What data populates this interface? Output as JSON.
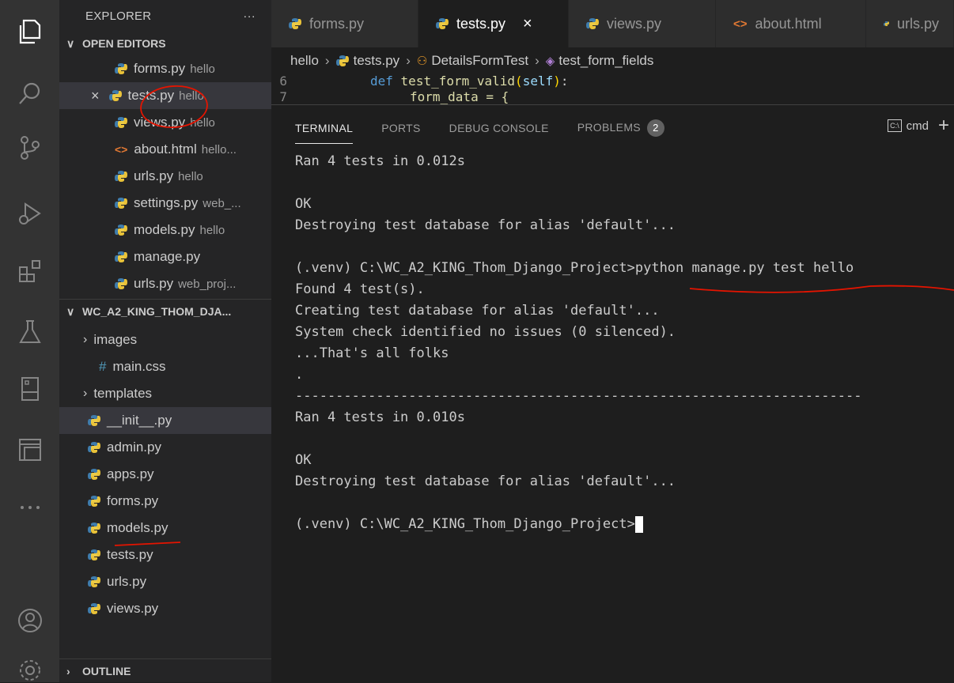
{
  "sidebar": {
    "title": "EXPLORER",
    "more": "···",
    "open_editors": {
      "label": "OPEN EDITORS",
      "items": [
        {
          "name": "forms.py",
          "desc": "hello"
        },
        {
          "name": "tests.py",
          "desc": "hello"
        },
        {
          "name": "views.py",
          "desc": "hello"
        },
        {
          "name": "about.html",
          "desc": "hello..."
        },
        {
          "name": "urls.py",
          "desc": "hello"
        },
        {
          "name": "settings.py",
          "desc": "web_..."
        },
        {
          "name": "models.py",
          "desc": "hello"
        },
        {
          "name": "manage.py",
          "desc": ""
        },
        {
          "name": "urls.py",
          "desc": "web_proj..."
        }
      ]
    },
    "project": {
      "label": "WC_A2_KING_THOM_DJA...",
      "items": [
        {
          "name": "images",
          "kind": "folder"
        },
        {
          "name": "main.css",
          "kind": "css"
        },
        {
          "name": "templates",
          "kind": "folder"
        },
        {
          "name": "__init__.py",
          "kind": "py"
        },
        {
          "name": "admin.py",
          "kind": "py"
        },
        {
          "name": "apps.py",
          "kind": "py"
        },
        {
          "name": "forms.py",
          "kind": "py"
        },
        {
          "name": "models.py",
          "kind": "py"
        },
        {
          "name": "tests.py",
          "kind": "py"
        },
        {
          "name": "urls.py",
          "kind": "py"
        },
        {
          "name": "views.py",
          "kind": "py"
        }
      ]
    },
    "outline": {
      "label": "OUTLINE"
    }
  },
  "tabs": [
    {
      "label": "forms.py",
      "icon": "python-icon"
    },
    {
      "label": "tests.py",
      "icon": "python-icon",
      "active": true
    },
    {
      "label": "views.py",
      "icon": "python-icon"
    },
    {
      "label": "about.html",
      "icon": "html-icon"
    },
    {
      "label": "urls.py",
      "icon": "python-icon"
    }
  ],
  "breadcrumb": {
    "folder": "hello",
    "file": "tests.py",
    "class": "DetailsFormTest",
    "method": "test_form_fields"
  },
  "editor": {
    "line6_num": "6",
    "line6_kw": "def",
    "line6_fn": "test_form_valid",
    "line6_param": "self",
    "line7_num": "7",
    "line7_text": "form_data = {"
  },
  "panel": {
    "tabs": {
      "terminal": "TERMINAL",
      "ports": "PORTS",
      "debug": "DEBUG CONSOLE",
      "problems": "PROBLEMS",
      "problems_count": "2"
    },
    "shell": "cmd",
    "lines": [
      "Ran 4 tests in 0.012s",
      "",
      "OK",
      "Destroying test database for alias 'default'...",
      "",
      "(.venv) C:\\WC_A2_KING_Thom_Django_Project>python manage.py test hello",
      "Found 4 test(s).",
      "Creating test database for alias 'default'...",
      "System check identified no issues (0 silenced).",
      "...That's all folks",
      ".",
      "----------------------------------------------------------------------",
      "Ran 4 tests in 0.010s",
      "",
      "OK",
      "Destroying test database for alias 'default'...",
      "",
      "(.venv) C:\\WC_A2_KING_Thom_Django_Project>"
    ]
  },
  "colors": {
    "python_blue": "#3f7cac",
    "python_yellow": "#ffd43b",
    "annotation_red": "#e51400"
  }
}
